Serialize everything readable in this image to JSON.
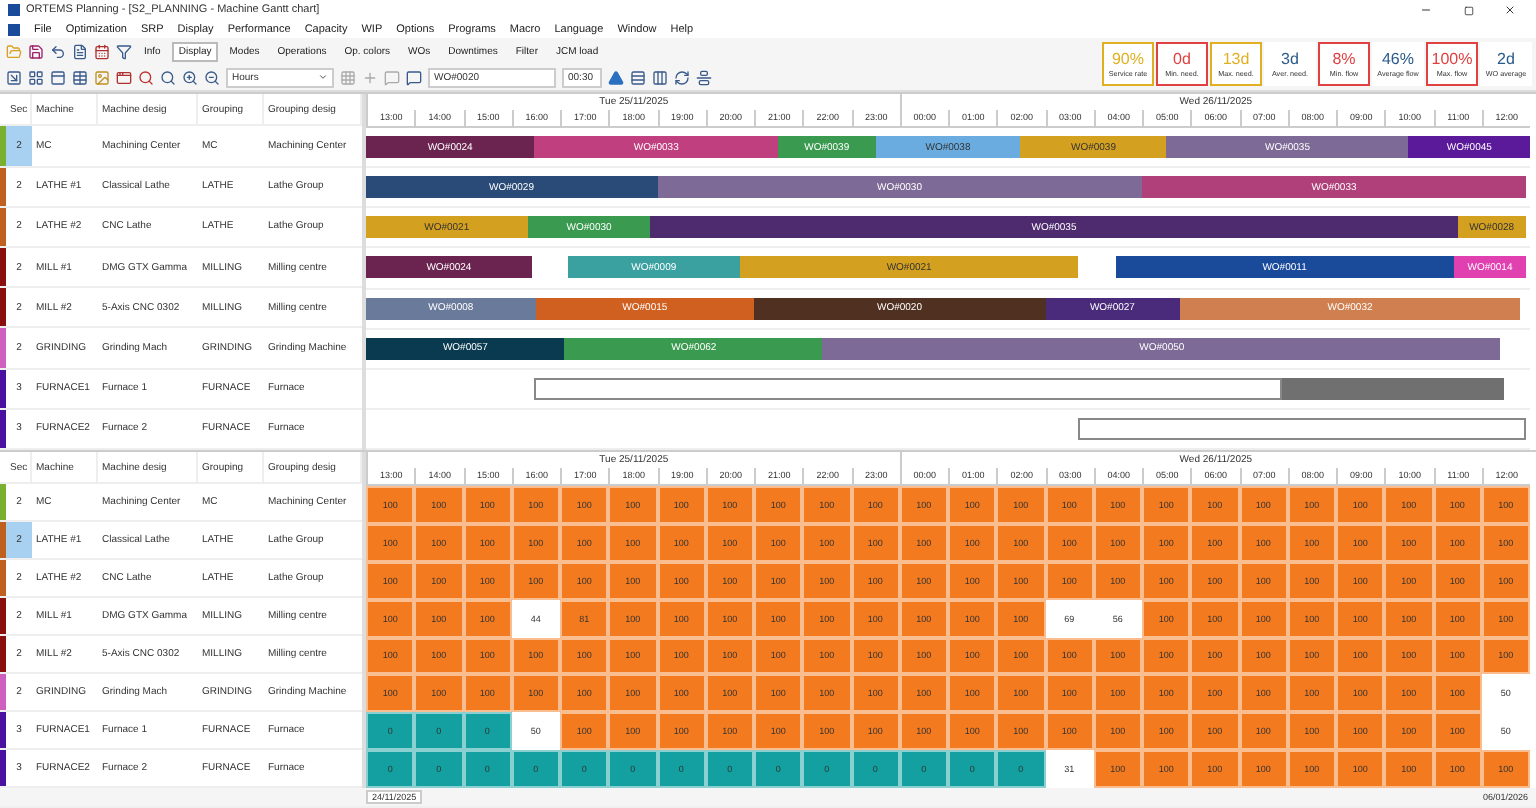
{
  "window": {
    "title": "ORTEMS   Planning - [S2_PLANNING - Machine Gantt chart]"
  },
  "menu": [
    "File",
    "Optimization",
    "SRP",
    "Display",
    "Performance",
    "Capacity",
    "WIP",
    "Options",
    "Programs",
    "Macro",
    "Language",
    "Window",
    "Help"
  ],
  "toolbar": {
    "tabs": [
      {
        "label": "Info",
        "selected": false
      },
      {
        "label": "Display",
        "selected": true
      },
      {
        "label": "Modes",
        "selected": false
      },
      {
        "label": "Operations",
        "selected": false
      },
      {
        "label": "Op. colors",
        "selected": false
      },
      {
        "label": "WOs",
        "selected": false
      },
      {
        "label": "Downtimes",
        "selected": false
      },
      {
        "label": "Filter",
        "selected": false
      },
      {
        "label": "JCM load",
        "selected": false
      }
    ],
    "scale": "Hours",
    "wo_field": "WO#0020",
    "time_field": "00:30"
  },
  "kpis": [
    {
      "value": "90%",
      "label": "Service rate",
      "color": "#e0b020",
      "outlined": true
    },
    {
      "value": "0d",
      "label": "Min. need.",
      "color": "#e04040",
      "outlined": true
    },
    {
      "value": "13d",
      "label": "Max. need.",
      "color": "#e0b020",
      "outlined": true
    },
    {
      "value": "3d",
      "label": "Aver. need.",
      "color": "#2a5a8a",
      "outlined": false
    },
    {
      "value": "8%",
      "label": "Min. flow",
      "color": "#e04040",
      "outlined": true
    },
    {
      "value": "46%",
      "label": "Average flow",
      "color": "#2a5a8a",
      "outlined": false
    },
    {
      "value": "100%",
      "label": "Max. flow",
      "color": "#e04040",
      "outlined": true
    },
    {
      "value": "2d",
      "label": "WO average",
      "color": "#2a5a8a",
      "outlined": false
    }
  ],
  "gantt": {
    "columns": [
      "Sec",
      "Machine",
      "Machine desig",
      "Grouping",
      "Grouping desig"
    ],
    "days": [
      {
        "label": "Tue 25/11/2025",
        "hours": [
          "13:00",
          "14:00",
          "15:00",
          "16:00",
          "17:00",
          "18:00",
          "19:00",
          "20:00",
          "21:00",
          "22:00",
          "23:00"
        ]
      },
      {
        "label": "Wed 26/11/2025",
        "hours": [
          "00:00",
          "01:00",
          "02:00",
          "03:00",
          "04:00",
          "05:00",
          "06:00",
          "07:00",
          "08:00",
          "09:00",
          "10:00",
          "11:00",
          "12:00"
        ]
      }
    ],
    "rows": [
      {
        "sec": "2",
        "machine": "MC",
        "machine_desig": "Machining Center",
        "grouping": "MC",
        "grouping_desig": "Machining Center",
        "color": "#7ab030",
        "selected": true,
        "bars": [
          {
            "kind": "order",
            "label": "WO#0024",
            "color": "#6b2450"
          },
          {
            "kind": "order",
            "label": "WO#0033",
            "color": "#c0407f"
          },
          {
            "kind": "order",
            "label": "WO#0039",
            "color": "#3a9a50"
          },
          {
            "kind": "order",
            "label": "WO#0038",
            "color": "#6aace0"
          },
          {
            "kind": "order",
            "label": "WO#0039",
            "color": "#d4a020"
          },
          {
            "kind": "order",
            "label": "WO#0035",
            "color": "#7e6a96"
          },
          {
            "kind": "order",
            "label": "WO#0045",
            "color": "#5a1a9a"
          }
        ]
      },
      {
        "sec": "2",
        "machine": "LATHE #1",
        "machine_desig": "Classical Lathe",
        "grouping": "LATHE",
        "grouping_desig": "Lathe Group",
        "color": "#c06020",
        "selected": false,
        "bars": [
          {
            "kind": "order",
            "label": "WO#0029",
            "color": "#2a4a78"
          },
          {
            "kind": "order",
            "label": "WO#0030",
            "color": "#7e6a96"
          },
          {
            "kind": "order",
            "label": "WO#0033",
            "color": "#b0407a"
          }
        ]
      },
      {
        "sec": "2",
        "machine": "LATHE #2",
        "machine_desig": "CNC Lathe",
        "grouping": "LATHE",
        "grouping_desig": "Lathe Group",
        "color": "#c06020",
        "selected": false,
        "bars": [
          {
            "kind": "order",
            "label": "WO#0021",
            "color": "#d4a020"
          },
          {
            "kind": "order",
            "label": "WO#0030",
            "color": "#3a9a50"
          },
          {
            "kind": "order",
            "label": "WO#0035",
            "color": "#4e2a6e"
          },
          {
            "kind": "order",
            "label": "WO#0028",
            "color": "#d4a020"
          }
        ]
      },
      {
        "sec": "2",
        "machine": "MILL #1",
        "machine_desig": "DMG GTX Gamma",
        "grouping": "MILLING",
        "grouping_desig": "Milling centre",
        "color": "#8a1010",
        "selected": false,
        "bars": [
          {
            "kind": "order",
            "label": "WO#0024",
            "color": "#6b2450"
          },
          {
            "kind": "order",
            "label": "WO#0009",
            "color": "#3aa0a0"
          },
          {
            "kind": "order",
            "label": "WO#0021",
            "color": "#d4a020"
          },
          {
            "kind": "order",
            "label": "WO#0011",
            "color": "#1a4a9a"
          },
          {
            "kind": "order",
            "label": "WO#0014",
            "color": "#e040b0"
          }
        ]
      },
      {
        "sec": "2",
        "machine": "MILL #2",
        "machine_desig": "5-Axis CNC 0302",
        "grouping": "MILLING",
        "grouping_desig": "Milling centre",
        "color": "#8a1010",
        "selected": false,
        "bars": [
          {
            "kind": "order",
            "label": "WO#0008",
            "color": "#6a7a9a"
          },
          {
            "kind": "order",
            "label": "WO#0015",
            "color": "#d06020"
          },
          {
            "kind": "order",
            "label": "WO#0020",
            "color": "#503020"
          },
          {
            "kind": "order",
            "label": "WO#0027",
            "color": "#4a2a7a"
          },
          {
            "kind": "order",
            "label": "WO#0032",
            "color": "#d08050"
          }
        ]
      },
      {
        "sec": "2",
        "machine": "GRINDING",
        "machine_desig": "Grinding Mach",
        "grouping": "GRINDING",
        "grouping_desig": "Grinding Machine",
        "color": "#d060c0",
        "selected": false,
        "bars": [
          {
            "kind": "order",
            "label": "WO#0057",
            "color": "#0a3a50"
          },
          {
            "kind": "order",
            "label": "WO#0062",
            "color": "#3a9a50"
          },
          {
            "kind": "order",
            "label": "WO#0050",
            "color": "#7e6a96"
          }
        ]
      },
      {
        "sec": "3",
        "machine": "FURNACE1",
        "machine_desig": "Furnace 1",
        "grouping": "FURNACE",
        "grouping_desig": "Furnace",
        "color": "#4a10a0",
        "selected": false,
        "bars": [
          {
            "kind": "outline"
          },
          {
            "kind": "block",
            "color": "#707070"
          }
        ]
      },
      {
        "sec": "3",
        "machine": "FURNACE2",
        "machine_desig": "Furnace 2",
        "grouping": "FURNACE",
        "grouping_desig": "Furnace",
        "color": "#4a10a0",
        "selected": false,
        "bars": [
          {
            "kind": "outline"
          }
        ]
      }
    ]
  },
  "load": {
    "columns": [
      "Sec",
      "Machine",
      "Machine desig",
      "Grouping",
      "Grouping desig"
    ],
    "days": [
      {
        "label": "Tue 25/11/2025",
        "hours": [
          "13:00",
          "14:00",
          "15:00",
          "16:00",
          "17:00",
          "18:00",
          "19:00",
          "20:00",
          "21:00",
          "22:00",
          "23:00"
        ]
      },
      {
        "label": "Wed 26/11/2025",
        "hours": [
          "00:00",
          "01:00",
          "02:00",
          "03:00",
          "04:00",
          "05:00",
          "06:00",
          "07:00",
          "08:00",
          "09:00",
          "10:00",
          "11:00",
          "12:00"
        ]
      }
    ],
    "rows": [
      {
        "sec": "2",
        "machine": "MC",
        "machine_desig": "Machining Center",
        "grouping": "MC",
        "grouping_desig": "Machining Center",
        "color": "#7ab030",
        "selected": false,
        "cells": [
          {
            "v": "100",
            "kind": "loaded"
          },
          {
            "v": "100",
            "kind": "loaded"
          },
          {
            "v": "100",
            "kind": "loaded"
          },
          {
            "v": "100",
            "kind": "loaded"
          },
          {
            "v": "100",
            "kind": "loaded"
          },
          {
            "v": "100",
            "kind": "loaded"
          },
          {
            "v": "100",
            "kind": "loaded"
          },
          {
            "v": "100",
            "kind": "loaded"
          },
          {
            "v": "100",
            "kind": "loaded"
          },
          {
            "v": "100",
            "kind": "loaded"
          },
          {
            "v": "100",
            "kind": "loaded"
          },
          {
            "v": "100",
            "kind": "loaded"
          },
          {
            "v": "100",
            "kind": "loaded"
          },
          {
            "v": "100",
            "kind": "loaded"
          },
          {
            "v": "100",
            "kind": "loaded"
          },
          {
            "v": "100",
            "kind": "loaded"
          },
          {
            "v": "100",
            "kind": "loaded"
          },
          {
            "v": "100",
            "kind": "loaded"
          },
          {
            "v": "100",
            "kind": "loaded"
          },
          {
            "v": "100",
            "kind": "loaded"
          },
          {
            "v": "100",
            "kind": "loaded"
          },
          {
            "v": "100",
            "kind": "loaded"
          },
          {
            "v": "100",
            "kind": "loaded"
          },
          {
            "v": "100",
            "kind": "loaded"
          }
        ]
      },
      {
        "sec": "2",
        "machine": "LATHE #1",
        "machine_desig": "Classical Lathe",
        "grouping": "LATHE",
        "grouping_desig": "Lathe Group",
        "color": "#c06020",
        "selected": true,
        "cells": [
          {
            "v": "100",
            "kind": "loaded"
          },
          {
            "v": "100",
            "kind": "loaded"
          },
          {
            "v": "100",
            "kind": "loaded"
          },
          {
            "v": "100",
            "kind": "loaded"
          },
          {
            "v": "100",
            "kind": "loaded"
          },
          {
            "v": "100",
            "kind": "loaded"
          },
          {
            "v": "100",
            "kind": "loaded"
          },
          {
            "v": "100",
            "kind": "loaded"
          },
          {
            "v": "100",
            "kind": "loaded"
          },
          {
            "v": "100",
            "kind": "loaded"
          },
          {
            "v": "100",
            "kind": "loaded"
          },
          {
            "v": "100",
            "kind": "loaded"
          },
          {
            "v": "100",
            "kind": "loaded"
          },
          {
            "v": "100",
            "kind": "loaded"
          },
          {
            "v": "100",
            "kind": "loaded"
          },
          {
            "v": "100",
            "kind": "loaded"
          },
          {
            "v": "100",
            "kind": "loaded"
          },
          {
            "v": "100",
            "kind": "loaded"
          },
          {
            "v": "100",
            "kind": "loaded"
          },
          {
            "v": "100",
            "kind": "loaded"
          },
          {
            "v": "100",
            "kind": "loaded"
          },
          {
            "v": "100",
            "kind": "loaded"
          },
          {
            "v": "100",
            "kind": "loaded"
          },
          {
            "v": "100",
            "kind": "loaded"
          }
        ]
      },
      {
        "sec": "2",
        "machine": "LATHE #2",
        "machine_desig": "CNC Lathe",
        "grouping": "LATHE",
        "grouping_desig": "Lathe Group",
        "color": "#c06020",
        "selected": false,
        "cells": [
          {
            "v": "100",
            "kind": "loaded"
          },
          {
            "v": "100",
            "kind": "loaded"
          },
          {
            "v": "100",
            "kind": "loaded"
          },
          {
            "v": "100",
            "kind": "loaded"
          },
          {
            "v": "100",
            "kind": "loaded"
          },
          {
            "v": "100",
            "kind": "loaded"
          },
          {
            "v": "100",
            "kind": "loaded"
          },
          {
            "v": "100",
            "kind": "loaded"
          },
          {
            "v": "100",
            "kind": "loaded"
          },
          {
            "v": "100",
            "kind": "loaded"
          },
          {
            "v": "100",
            "kind": "loaded"
          },
          {
            "v": "100",
            "kind": "loaded"
          },
          {
            "v": "100",
            "kind": "loaded"
          },
          {
            "v": "100",
            "kind": "loaded"
          },
          {
            "v": "100",
            "kind": "loaded"
          },
          {
            "v": "100",
            "kind": "loaded"
          },
          {
            "v": "100",
            "kind": "loaded"
          },
          {
            "v": "100",
            "kind": "loaded"
          },
          {
            "v": "100",
            "kind": "loaded"
          },
          {
            "v": "100",
            "kind": "loaded"
          },
          {
            "v": "100",
            "kind": "loaded"
          },
          {
            "v": "100",
            "kind": "loaded"
          },
          {
            "v": "100",
            "kind": "loaded"
          },
          {
            "v": "100",
            "kind": "loaded"
          }
        ]
      },
      {
        "sec": "2",
        "machine": "MILL #1",
        "machine_desig": "DMG GTX Gamma",
        "grouping": "MILLING",
        "grouping_desig": "Milling centre",
        "color": "#8a1010",
        "selected": false,
        "cells": [
          {
            "v": "100",
            "kind": "loaded"
          },
          {
            "v": "100",
            "kind": "loaded"
          },
          {
            "v": "100",
            "kind": "loaded"
          },
          {
            "v": "44",
            "kind": "partial"
          },
          {
            "v": "81",
            "kind": "loaded"
          },
          {
            "v": "100",
            "kind": "loaded"
          },
          {
            "v": "100",
            "kind": "loaded"
          },
          {
            "v": "100",
            "kind": "loaded"
          },
          {
            "v": "100",
            "kind": "loaded"
          },
          {
            "v": "100",
            "kind": "loaded"
          },
          {
            "v": "100",
            "kind": "loaded"
          },
          {
            "v": "100",
            "kind": "loaded"
          },
          {
            "v": "100",
            "kind": "loaded"
          },
          {
            "v": "100",
            "kind": "loaded"
          },
          {
            "v": "69",
            "kind": "partial"
          },
          {
            "v": "56",
            "kind": "partial"
          },
          {
            "v": "100",
            "kind": "loaded"
          },
          {
            "v": "100",
            "kind": "loaded"
          },
          {
            "v": "100",
            "kind": "loaded"
          },
          {
            "v": "100",
            "kind": "loaded"
          },
          {
            "v": "100",
            "kind": "loaded"
          },
          {
            "v": "100",
            "kind": "loaded"
          },
          {
            "v": "100",
            "kind": "loaded"
          },
          {
            "v": "100",
            "kind": "loaded"
          }
        ]
      },
      {
        "sec": "2",
        "machine": "MILL #2",
        "machine_desig": "5-Axis CNC 0302",
        "grouping": "MILLING",
        "grouping_desig": "Milling centre",
        "color": "#8a1010",
        "selected": false,
        "cells": [
          {
            "v": "100",
            "kind": "loaded"
          },
          {
            "v": "100",
            "kind": "loaded"
          },
          {
            "v": "100",
            "kind": "loaded"
          },
          {
            "v": "100",
            "kind": "loaded"
          },
          {
            "v": "100",
            "kind": "loaded"
          },
          {
            "v": "100",
            "kind": "loaded"
          },
          {
            "v": "100",
            "kind": "loaded"
          },
          {
            "v": "100",
            "kind": "loaded"
          },
          {
            "v": "100",
            "kind": "loaded"
          },
          {
            "v": "100",
            "kind": "loaded"
          },
          {
            "v": "100",
            "kind": "loaded"
          },
          {
            "v": "100",
            "kind": "loaded"
          },
          {
            "v": "100",
            "kind": "loaded"
          },
          {
            "v": "100",
            "kind": "loaded"
          },
          {
            "v": "100",
            "kind": "loaded"
          },
          {
            "v": "100",
            "kind": "loaded"
          },
          {
            "v": "100",
            "kind": "loaded"
          },
          {
            "v": "100",
            "kind": "loaded"
          },
          {
            "v": "100",
            "kind": "loaded"
          },
          {
            "v": "100",
            "kind": "loaded"
          },
          {
            "v": "100",
            "kind": "loaded"
          },
          {
            "v": "100",
            "kind": "loaded"
          },
          {
            "v": "100",
            "kind": "loaded"
          },
          {
            "v": "100",
            "kind": "loaded"
          }
        ]
      },
      {
        "sec": "2",
        "machine": "GRINDING",
        "machine_desig": "Grinding Mach",
        "grouping": "GRINDING",
        "grouping_desig": "Grinding Machine",
        "color": "#d060c0",
        "selected": false,
        "cells": [
          {
            "v": "100",
            "kind": "loaded"
          },
          {
            "v": "100",
            "kind": "loaded"
          },
          {
            "v": "100",
            "kind": "loaded"
          },
          {
            "v": "100",
            "kind": "loaded"
          },
          {
            "v": "100",
            "kind": "loaded"
          },
          {
            "v": "100",
            "kind": "loaded"
          },
          {
            "v": "100",
            "kind": "loaded"
          },
          {
            "v": "100",
            "kind": "loaded"
          },
          {
            "v": "100",
            "kind": "loaded"
          },
          {
            "v": "100",
            "kind": "loaded"
          },
          {
            "v": "100",
            "kind": "loaded"
          },
          {
            "v": "100",
            "kind": "loaded"
          },
          {
            "v": "100",
            "kind": "loaded"
          },
          {
            "v": "100",
            "kind": "loaded"
          },
          {
            "v": "100",
            "kind": "loaded"
          },
          {
            "v": "100",
            "kind": "loaded"
          },
          {
            "v": "100",
            "kind": "loaded"
          },
          {
            "v": "100",
            "kind": "loaded"
          },
          {
            "v": "100",
            "kind": "loaded"
          },
          {
            "v": "100",
            "kind": "loaded"
          },
          {
            "v": "100",
            "kind": "loaded"
          },
          {
            "v": "100",
            "kind": "loaded"
          },
          {
            "v": "100",
            "kind": "loaded"
          },
          {
            "v": "50",
            "kind": "partial"
          }
        ]
      },
      {
        "sec": "3",
        "machine": "FURNACE1",
        "machine_desig": "Furnace 1",
        "grouping": "FURNACE",
        "grouping_desig": "Furnace",
        "color": "#4a10a0",
        "selected": false,
        "cells": [
          {
            "v": "0",
            "kind": "idle"
          },
          {
            "v": "0",
            "kind": "idle"
          },
          {
            "v": "0",
            "kind": "idle"
          },
          {
            "v": "50",
            "kind": "partial"
          },
          {
            "v": "100",
            "kind": "loaded"
          },
          {
            "v": "100",
            "kind": "loaded"
          },
          {
            "v": "100",
            "kind": "loaded"
          },
          {
            "v": "100",
            "kind": "loaded"
          },
          {
            "v": "100",
            "kind": "loaded"
          },
          {
            "v": "100",
            "kind": "loaded"
          },
          {
            "v": "100",
            "kind": "loaded"
          },
          {
            "v": "100",
            "kind": "loaded"
          },
          {
            "v": "100",
            "kind": "loaded"
          },
          {
            "v": "100",
            "kind": "loaded"
          },
          {
            "v": "100",
            "kind": "loaded"
          },
          {
            "v": "100",
            "kind": "loaded"
          },
          {
            "v": "100",
            "kind": "loaded"
          },
          {
            "v": "100",
            "kind": "loaded"
          },
          {
            "v": "100",
            "kind": "loaded"
          },
          {
            "v": "100",
            "kind": "loaded"
          },
          {
            "v": "100",
            "kind": "loaded"
          },
          {
            "v": "100",
            "kind": "loaded"
          },
          {
            "v": "100",
            "kind": "loaded"
          },
          {
            "v": "50",
            "kind": "partial"
          }
        ]
      },
      {
        "sec": "3",
        "machine": "FURNACE2",
        "machine_desig": "Furnace 2",
        "grouping": "FURNACE",
        "grouping_desig": "Furnace",
        "color": "#4a10a0",
        "selected": false,
        "cells": [
          {
            "v": "0",
            "kind": "idle"
          },
          {
            "v": "0",
            "kind": "idle"
          },
          {
            "v": "0",
            "kind": "idle"
          },
          {
            "v": "0",
            "kind": "idle"
          },
          {
            "v": "0",
            "kind": "idle"
          },
          {
            "v": "0",
            "kind": "idle"
          },
          {
            "v": "0",
            "kind": "idle"
          },
          {
            "v": "0",
            "kind": "idle"
          },
          {
            "v": "0",
            "kind": "idle"
          },
          {
            "v": "0",
            "kind": "idle"
          },
          {
            "v": "0",
            "kind": "idle"
          },
          {
            "v": "0",
            "kind": "idle"
          },
          {
            "v": "0",
            "kind": "idle"
          },
          {
            "v": "0",
            "kind": "idle"
          },
          {
            "v": "31",
            "kind": "partial"
          },
          {
            "v": "100",
            "kind": "loaded"
          },
          {
            "v": "100",
            "kind": "loaded"
          },
          {
            "v": "100",
            "kind": "loaded"
          },
          {
            "v": "100",
            "kind": "loaded"
          },
          {
            "v": "100",
            "kind": "loaded"
          },
          {
            "v": "100",
            "kind": "loaded"
          },
          {
            "v": "100",
            "kind": "loaded"
          },
          {
            "v": "100",
            "kind": "loaded"
          },
          {
            "v": "100",
            "kind": "loaded"
          }
        ]
      }
    ],
    "range_start": "24/11/2025",
    "range_end": "06/01/2026"
  }
}
